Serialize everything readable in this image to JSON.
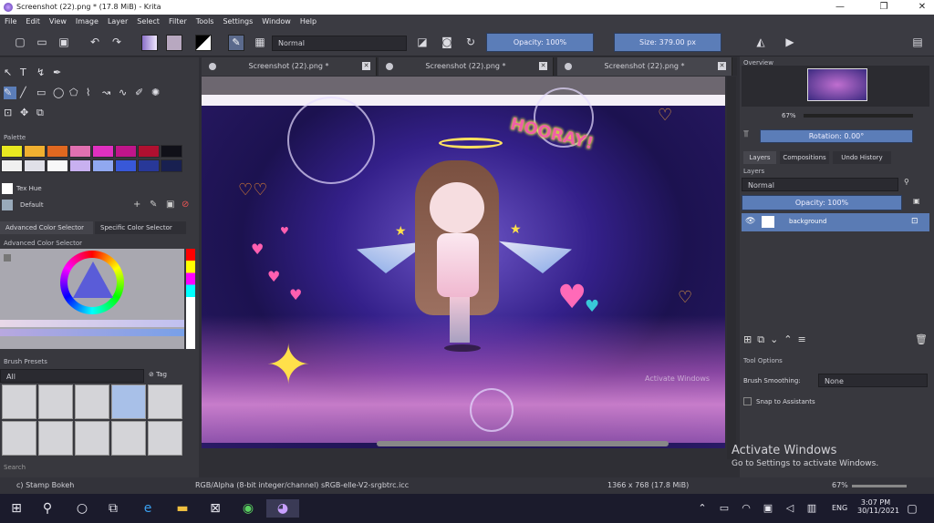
{
  "title": "Screenshot (22).png * (17.8 MiB)  - Krita",
  "menu": [
    "File",
    "Edit",
    "View",
    "Image",
    "Layer",
    "Select",
    "Filter",
    "Tools",
    "Settings",
    "Window",
    "Help"
  ],
  "toolbar": {
    "blend_mode": "Normal",
    "opacity": "Opacity: 100%",
    "size": "Size: 379.00 px"
  },
  "tabs": [
    {
      "label": "Screenshot (22).png *"
    },
    {
      "label": "Screenshot (22).png *"
    },
    {
      "label": "Screenshot (22).png *"
    }
  ],
  "left": {
    "palette_title": "Palette",
    "palette_colors": [
      "#e8e820",
      "#f0b030",
      "#e06820",
      "#e070b0",
      "#e030c0",
      "#c0158a",
      "#b01030",
      "#101018",
      "#f0f0f0",
      "#e0e0e8",
      "#f8f8f8",
      "#c8b0f0",
      "#90a8f0",
      "#3858d8",
      "#283898",
      "#182050"
    ],
    "color_name": "Tex Hue",
    "default_label": "Default",
    "tab_advanced": "Advanced Color Selector",
    "tab_specific": "Specific Color Selector",
    "acs_title": "Advanced Color Selector",
    "brush_presets_title": "Brush Presets",
    "brush_filter": "All",
    "brush_tag": "Tag",
    "search": "Search"
  },
  "right": {
    "overview_title": "Overview",
    "zoom": "67%",
    "rotation": "Rotation: 0.00°",
    "tabs": [
      "Layers",
      "Compositions",
      "Undo History"
    ],
    "layers_title": "Layers",
    "blend": "Normal",
    "opacity": "Opacity: 100%",
    "layer_name": "background",
    "tool_options_title": "Tool Options",
    "brush_smoothing_label": "Brush Smoothing:",
    "brush_smoothing_value": "None",
    "snap_label": "Snap to Assistants"
  },
  "canvas": {
    "sticker": "HOORAY!",
    "watermark": "Activate Windows"
  },
  "status": {
    "brush": "c) Stamp Bokeh",
    "colorspace": "RGB/Alpha (8-bit integer/channel)  sRGB-elle-V2-srgbtrc.icc",
    "dims": "1366 x 768 (17.8 MiB)",
    "zoom": "67%"
  },
  "activate": {
    "title": "Activate Windows",
    "sub": "Go to Settings to activate Windows."
  },
  "taskbar": {
    "lang": "ENG",
    "time": "3:07 PM",
    "date": "30/11/2021"
  }
}
